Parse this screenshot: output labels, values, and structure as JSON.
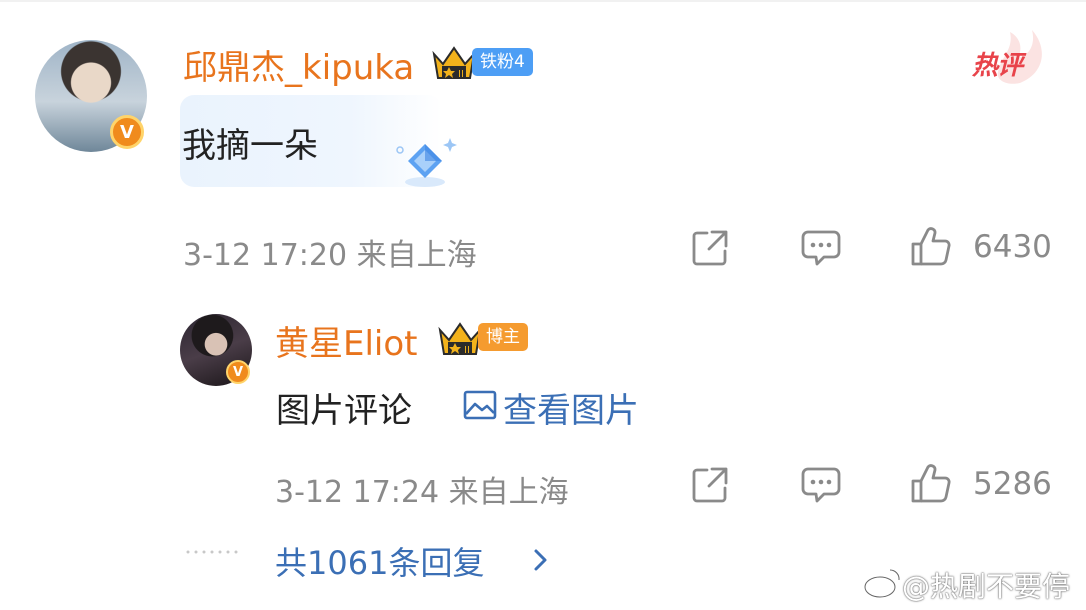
{
  "comment": {
    "username": "邱鼎杰_kipuka",
    "fan_tag": "铁粉4",
    "hot_label": "热评",
    "text": "我摘一朵",
    "time": "3-12 17:20",
    "location": "来自上海",
    "like_count": "6430"
  },
  "reply": {
    "username": "黄星Eliot",
    "role_tag": "博主",
    "text": "图片评论",
    "view_image_label": "查看图片",
    "time": "3-12 17:24",
    "location": "来自上海",
    "like_count": "5286"
  },
  "more_replies_label": "共1061条回复",
  "watermark": "@热剧不要停",
  "colors": {
    "username": "#e8741d",
    "link": "#3b6fb5",
    "meta": "#8a8a8a",
    "fan_tag": "#4d9ef5",
    "blogger_tag": "#f59b2f",
    "hot": "#e8434a"
  },
  "icons": [
    "crown-icon",
    "verified-icon",
    "share-icon",
    "comment-icon",
    "like-icon",
    "image-icon",
    "chevron-right-icon",
    "weibo-logo-icon"
  ]
}
